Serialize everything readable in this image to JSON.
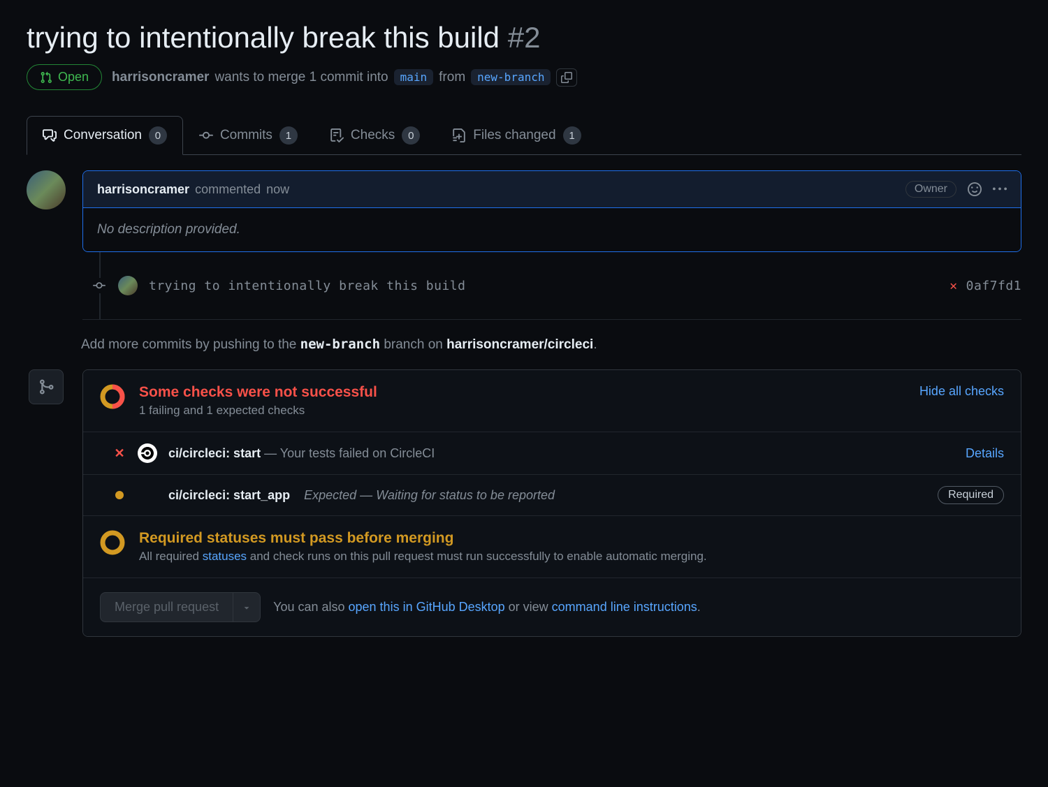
{
  "header": {
    "title": "trying to intentionally break this build",
    "number": "#2",
    "state": "Open",
    "author": "harrisoncramer",
    "merge_text_1": "wants to merge 1 commit into",
    "base_branch": "main",
    "from_text": "from",
    "head_branch": "new-branch"
  },
  "tabs": {
    "conversation": {
      "label": "Conversation",
      "count": "0"
    },
    "commits": {
      "label": "Commits",
      "count": "1"
    },
    "checks": {
      "label": "Checks",
      "count": "0"
    },
    "files": {
      "label": "Files changed",
      "count": "1"
    }
  },
  "comment": {
    "author": "harrisoncramer",
    "action": "commented",
    "time": "now",
    "role": "Owner",
    "body": "No description provided."
  },
  "commit": {
    "message": "trying to intentionally break this build",
    "sha": "0af7fd1"
  },
  "push_hint": {
    "prefix": "Add more commits by pushing to the ",
    "branch": "new-branch",
    "middle": " branch on ",
    "repo": "harrisoncramer/circleci",
    "suffix": "."
  },
  "checks_panel": {
    "summary_title": "Some checks were not successful",
    "summary_sub": "1 failing and 1 expected checks",
    "hide_link": "Hide all checks",
    "items": [
      {
        "status": "fail",
        "name": "ci/circleci: start",
        "sep": " — ",
        "desc": "Your tests failed on CircleCI",
        "action": "Details"
      },
      {
        "status": "pending",
        "name": "ci/circleci: start_app",
        "desc_prefix": "Expected",
        "sep": " — ",
        "desc": "Waiting for status to be reported",
        "badge": "Required"
      }
    ],
    "required_title": "Required statuses must pass before merging",
    "required_sub_1": "All required ",
    "required_link": "statuses",
    "required_sub_2": " and check runs on this pull request must run successfully to enable automatic merging."
  },
  "merge": {
    "button": "Merge pull request",
    "hint_1": "You can also ",
    "hint_link_1": "open this in GitHub Desktop",
    "hint_2": " or view ",
    "hint_link_2": "command line instructions",
    "hint_3": "."
  }
}
